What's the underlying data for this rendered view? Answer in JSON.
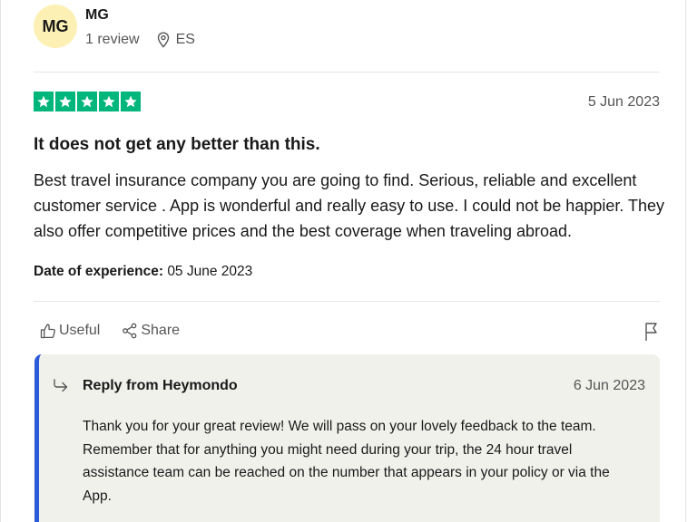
{
  "user": {
    "initials": "MG",
    "name": "MG",
    "reviews": "1 review",
    "country": "ES"
  },
  "review": {
    "rating": 5,
    "rating_max": 5,
    "date": "5 Jun 2023",
    "title": "It does not get any better than this.",
    "body": "Best travel insurance company you are going to find. Serious, reliable and excellent customer service . App is wonderful and really easy to use. I could not be happier. They also offer competitive prices and the best coverage when traveling abroad.",
    "experience_label": "Date of experience:",
    "experience_date": "05 June 2023"
  },
  "actions": {
    "useful": "Useful",
    "share": "Share"
  },
  "reply": {
    "from": "Reply from Heymondo",
    "date": "6 Jun 2023",
    "body": "Thank you for your great review! We will pass on your lovely feedback to the team. Remember that for anything you might need during your trip, the 24 hour travel assistance team can be reached on the number that appears in your policy or via the App."
  },
  "icons": {
    "location": "location-pin-icon",
    "star": "star-icon",
    "useful": "thumbs-up-icon",
    "share": "share-icon",
    "flag": "flag-icon",
    "reply": "reply-arrow-icon"
  },
  "colors": {
    "star_bg": "#00b67a",
    "avatar_bg": "#fcf0b4",
    "reply_accent": "#2b5bd9",
    "reply_bg": "#f1f1ec"
  }
}
